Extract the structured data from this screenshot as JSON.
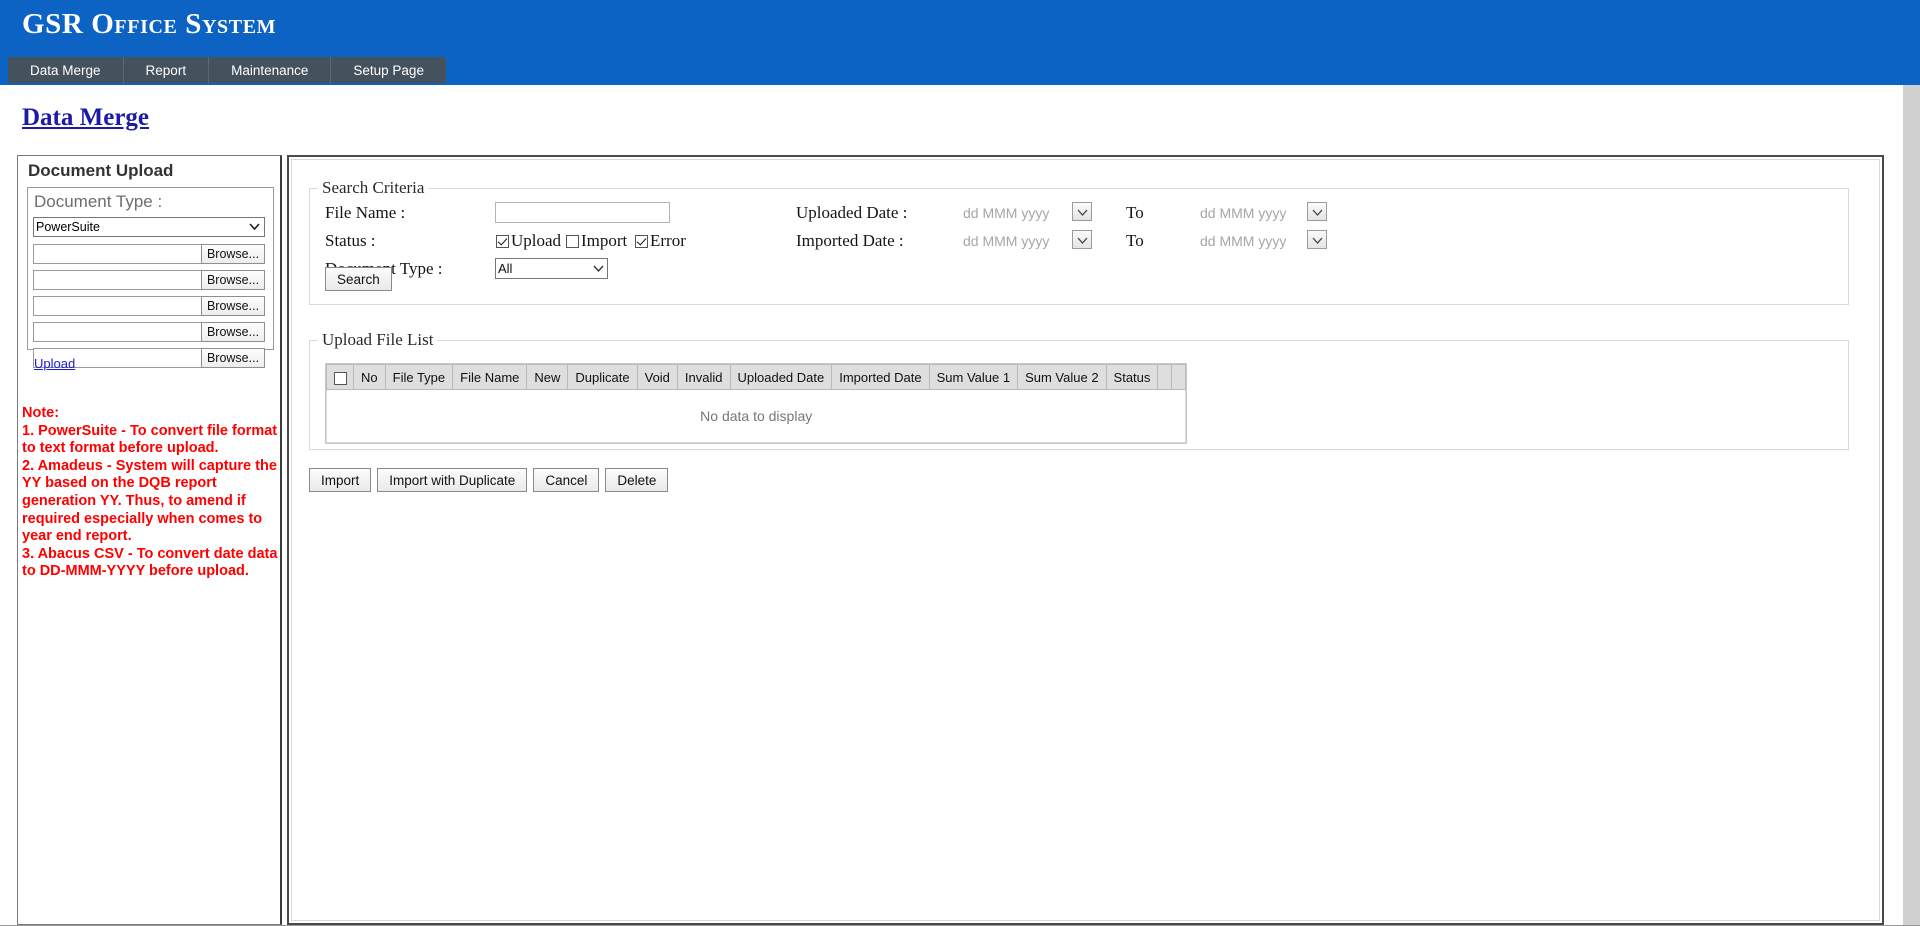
{
  "banner": {
    "title": "GSR Office System",
    "bg_color": "#0D63C4"
  },
  "nav": {
    "tabs": [
      {
        "label": "Data Merge"
      },
      {
        "label": "Report"
      },
      {
        "label": "Maintenance"
      },
      {
        "label": "Setup Page"
      }
    ],
    "tab_color": "#44525E"
  },
  "page": {
    "heading": "Data Merge",
    "heading_color": "#1B1BA8"
  },
  "document_upload": {
    "panel_title": "Document Upload",
    "doc_type_label": "Document Type :",
    "doc_type_value": "PowerSuite",
    "doc_type_options": [
      "PowerSuite"
    ],
    "browse_label": "Browse...",
    "file_rows": 5,
    "upload_link": "Upload",
    "note_color": "#FF0000",
    "note_lines": [
      "Note:",
      "1. PowerSuite - To convert file format to text format before upload.",
      "2. Amadeus - System will capture the YY based on the DQB report generation YY. Thus, to amend if required especially when comes to year end report.",
      "3. Abacus CSV - To convert date data to DD-MMM-YYYY before upload."
    ]
  },
  "search_criteria": {
    "legend": "Search Criteria",
    "file_name_label": "File Name :",
    "file_name_value": "",
    "status_label": "Status :",
    "status_options": [
      {
        "label": "Upload",
        "checked": true
      },
      {
        "label": "Import",
        "checked": false
      },
      {
        "label": "Error",
        "checked": true
      }
    ],
    "document_type_label": "Document Type :",
    "document_type_value": "All",
    "document_type_options": [
      "All"
    ],
    "uploaded_date_label": "Uploaded Date :",
    "imported_date_label": "Imported Date :",
    "date_placeholder": "dd MMM yyyy",
    "to_label": "To",
    "search_button": "Search"
  },
  "upload_file_list": {
    "legend": "Upload File List",
    "columns": [
      "No",
      "File Type",
      "File Name",
      "New",
      "Duplicate",
      "Void",
      "Invalid",
      "Uploaded Date",
      "Imported Date",
      "Sum Value 1",
      "Sum Value 2",
      "Status"
    ],
    "rows": [],
    "empty_message": "No data to display"
  },
  "actions": {
    "buttons": [
      {
        "label": "Import"
      },
      {
        "label": "Import with Duplicate"
      },
      {
        "label": "Cancel"
      },
      {
        "label": "Delete"
      }
    ]
  }
}
